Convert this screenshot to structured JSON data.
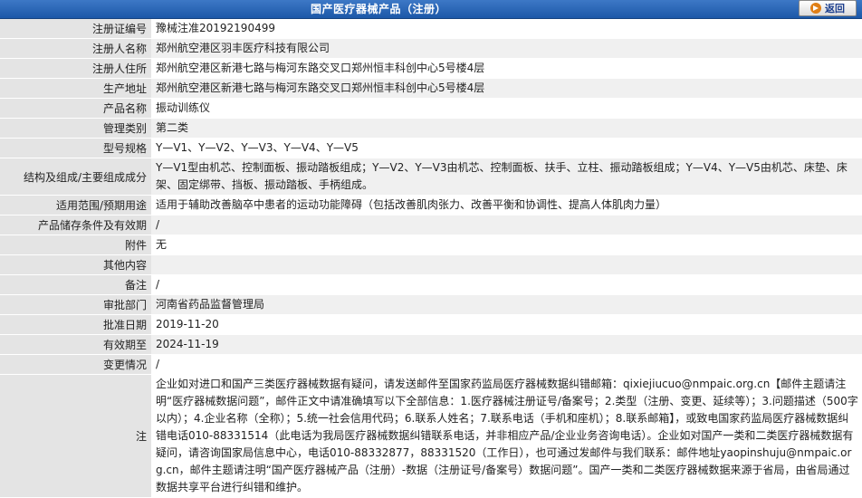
{
  "header": {
    "title": "国产医疗器械产品（注册）",
    "back_label": "返回",
    "accent": "#2a62b3",
    "back_icon": "arrow-right-circle-icon"
  },
  "fields": [
    {
      "key": "reg_no",
      "label": "注册证编号",
      "value": "豫械注准20192190499"
    },
    {
      "key": "registrant",
      "label": "注册人名称",
      "value": "郑州航空港区羽丰医疗科技有限公司"
    },
    {
      "key": "registrant_address",
      "label": "注册人住所",
      "value": "郑州航空港区新港七路与梅河东路交叉口郑州恒丰科创中心5号楼4层"
    },
    {
      "key": "production_address",
      "label": "生产地址",
      "value": "郑州航空港区新港七路与梅河东路交叉口郑州恒丰科创中心5号楼4层"
    },
    {
      "key": "product_name",
      "label": "产品名称",
      "value": "振动训练仪"
    },
    {
      "key": "category",
      "label": "管理类别",
      "value": "第二类"
    },
    {
      "key": "models",
      "label": "型号规格",
      "value": "Y—V1、Y—V2、Y—V3、Y—V4、Y—V5"
    },
    {
      "key": "composition",
      "label": "结构及组成/主要组成成分",
      "value": "Y—V1型由机芯、控制面板、振动踏板组成；Y—V2、Y—V3由机芯、控制面板、扶手、立柱、振动踏板组成；Y—V4、Y—V5由机芯、床垫、床架、固定绑带、挡板、振动踏板、手柄组成。"
    },
    {
      "key": "scope",
      "label": "适用范围/预期用途",
      "value": "适用于辅助改善脑卒中患者的运动功能障碍（包括改善肌肉张力、改善平衡和协调性、提高人体肌肉力量）"
    },
    {
      "key": "storage",
      "label": "产品储存条件及有效期",
      "value": "/"
    },
    {
      "key": "attachment",
      "label": "附件",
      "value": "无"
    },
    {
      "key": "other",
      "label": "其他内容",
      "value": ""
    },
    {
      "key": "remark",
      "label": "备注",
      "value": "/"
    },
    {
      "key": "approval_dept",
      "label": "审批部门",
      "value": "河南省药品监督管理局"
    },
    {
      "key": "approval_date",
      "label": "批准日期",
      "value": "2019-11-20"
    },
    {
      "key": "valid_until",
      "label": "有效期至",
      "value": "2024-11-19"
    },
    {
      "key": "changes",
      "label": "变更情况",
      "value": "/"
    }
  ],
  "note": {
    "label": "注",
    "text": "企业如对进口和国产三类医疗器械数据有疑问，请发送邮件至国家药监局医疗器械数据纠错邮箱：qixiejiucuo@nmpaic.org.cn【邮件主题请注明“医疗器械数据问题”，邮件正文中请准确填写以下全部信息：1.医疗器械注册证号/备案号；2.类型（注册、变更、延续等）；3.问题描述（500字以内）；4.企业名称（全称）；5.统一社会信用代码；6.联系人姓名；7.联系电话（手机和座机）；8.联系邮箱】，或致电国家药监局医疗器械数据纠错电话010-88331514（此电话为我局医疗器械数据纠错联系电话，并非相应产品/企业业务咨询电话）。企业如对国产一类和二类医疗器械数据有疑问，请咨询国家局信息中心，电话010-88332877，88331520（工作日），也可通过发邮件与我们联系：邮件地址yaopinshuju@nmpaic.org.cn，邮件主题请注明“国产医疗器械产品（注册）-数据（注册证号/备案号）数据问题”。国产一类和二类医疗器械数据来源于省局，由省局通过数据共享平台进行纠错和维护。"
  }
}
